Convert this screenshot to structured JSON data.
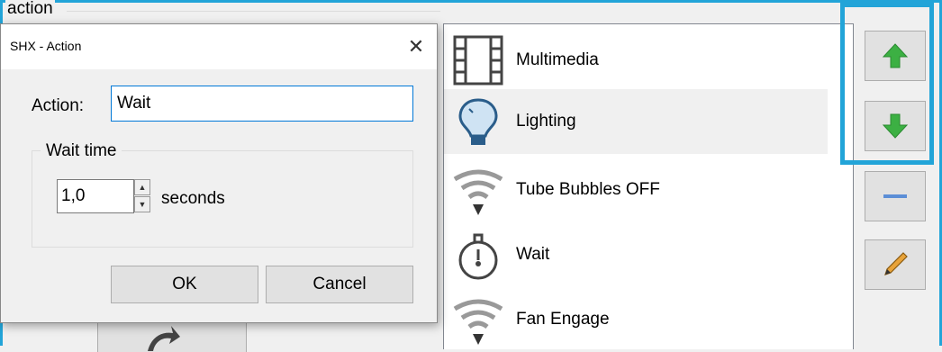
{
  "background": {
    "group_label": "action"
  },
  "dialog": {
    "title": "SHX - Action",
    "close_glyph": "✕",
    "action_label": "Action:",
    "action_value": "Wait",
    "wait_group_label": "Wait time",
    "wait_value": "1,0",
    "seconds_label": "seconds",
    "ok_label": "OK",
    "cancel_label": "Cancel"
  },
  "action_list": {
    "items": [
      {
        "label": "Multimedia",
        "icon": "film-icon"
      },
      {
        "label": "Lighting",
        "icon": "lightbulb-icon",
        "selected": true
      },
      {
        "label": "Tube Bubbles OFF",
        "icon": "wifi-icon"
      },
      {
        "label": "Wait",
        "icon": "stopwatch-icon"
      },
      {
        "label": "Fan Engage",
        "icon": "wifi-icon"
      }
    ]
  },
  "side_buttons": {
    "move_up_icon": "arrow-up-icon",
    "move_down_icon": "arrow-down-icon",
    "remove_icon": "minus-icon",
    "edit_icon": "pencil-icon"
  },
  "colors": {
    "highlight": "#22a4d8",
    "arrow_green": "#3cb043",
    "selection": "#f0f0f0"
  }
}
